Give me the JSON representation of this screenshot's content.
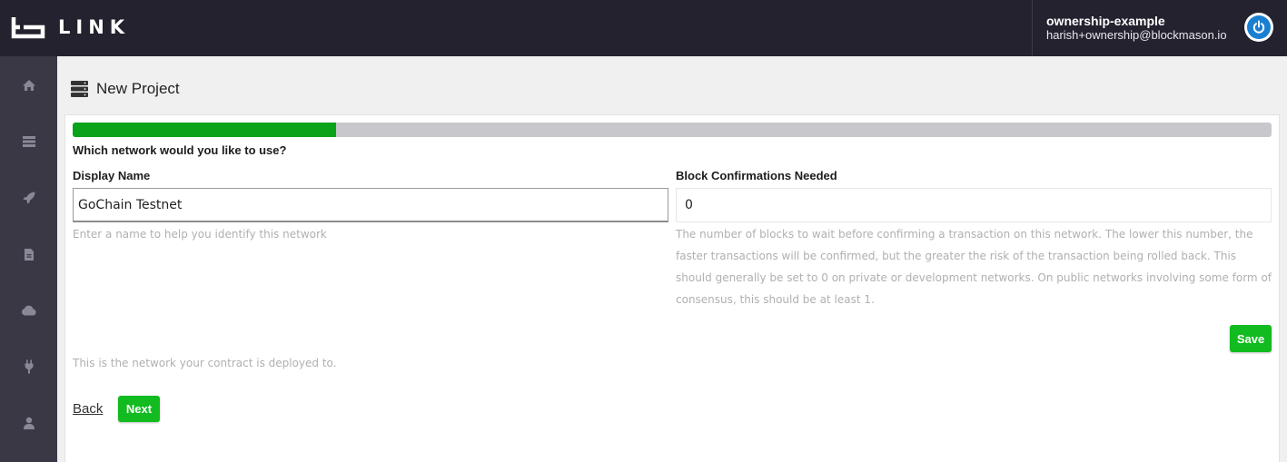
{
  "app": {
    "brand": "LINK",
    "icons": {
      "logo": "link-logo-mark",
      "power": "power-icon"
    },
    "colors": {
      "topbar": "#25222f",
      "sidebar": "#3b3846",
      "accent_green": "#12bb20",
      "progress_fill": "#0aa31a",
      "power_button": "#1a7fd0"
    }
  },
  "user": {
    "name": "ownership-example",
    "email": "harish+ownership@blockmason.io"
  },
  "sidebar": {
    "items": [
      {
        "icon": "home-icon"
      },
      {
        "icon": "server-icon"
      },
      {
        "icon": "rocket-icon"
      },
      {
        "icon": "document-icon"
      },
      {
        "icon": "cloud-icon"
      },
      {
        "icon": "plug-icon"
      },
      {
        "icon": "user-icon"
      }
    ]
  },
  "page": {
    "icon": "server-stack-icon",
    "title": "New Project"
  },
  "wizard": {
    "progress_percent": 22,
    "question": "Which network would you like to use?",
    "display_name": {
      "label": "Display Name",
      "value": "GoChain Testnet",
      "help": "Enter a name to help you identify this network"
    },
    "block_confirmations": {
      "label": "Block Confirmations Needed",
      "value": "0",
      "help": "The number of blocks to wait before confirming a transaction on this network. The lower this number, the faster transactions will be confirmed, but the greater the risk of the transaction being rolled back. This should generally be set to 0 on private or development networks. On public networks involving some form of consensus, this should be at least 1."
    },
    "save_label": "Save",
    "footer_note": "This is the network your contract is deployed to.",
    "back_label": "Back",
    "next_label": "Next"
  }
}
